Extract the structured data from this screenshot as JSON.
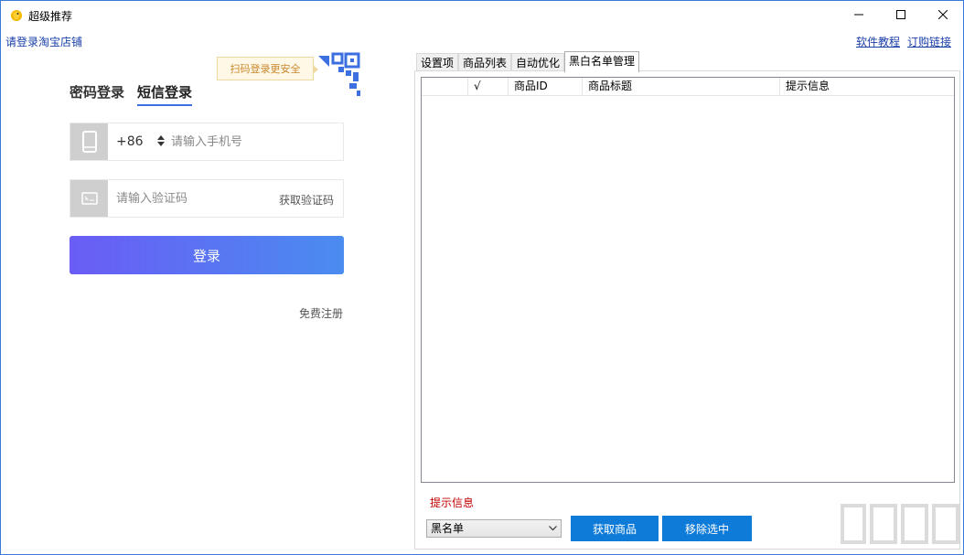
{
  "window": {
    "title": "超级推荐"
  },
  "header": {
    "login_hint": "请登录淘宝店铺",
    "tutorial_link": "软件教程",
    "buy_link": "订购链接"
  },
  "login": {
    "qr_tip": "扫码登录更安全",
    "tab_password": "密码登录",
    "tab_sms": "短信登录",
    "country_code": "+86",
    "phone_placeholder": "请输入手机号",
    "code_placeholder": "请输入验证码",
    "get_code": "获取验证码",
    "login_button": "登录",
    "register": "免费注册"
  },
  "tabs": [
    {
      "label": "设置项"
    },
    {
      "label": "商品列表"
    },
    {
      "label": "自动优化"
    },
    {
      "label": "黑白名单管理",
      "active": true
    }
  ],
  "table": {
    "columns": [
      "",
      "√",
      "商品ID",
      "商品标题",
      "提示信息"
    ]
  },
  "status": {
    "label": "提示信息"
  },
  "list_type": {
    "selected": "黑名单"
  },
  "buttons": {
    "fetch": "获取商品",
    "remove": "移除选中"
  },
  "colors": {
    "accent": "#0f7bd8",
    "link": "#1a3fa8",
    "status": "#c00000",
    "login_gradient_start": "#6a5cf5",
    "login_gradient_end": "#4a8cf0"
  }
}
